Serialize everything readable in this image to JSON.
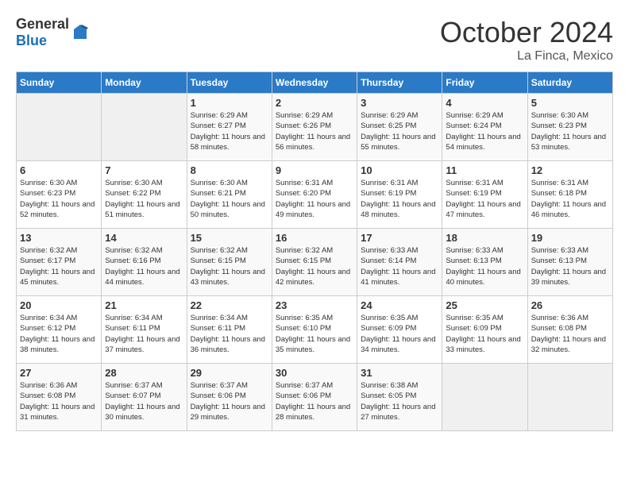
{
  "header": {
    "logo_general": "General",
    "logo_blue": "Blue",
    "month": "October 2024",
    "location": "La Finca, Mexico"
  },
  "weekdays": [
    "Sunday",
    "Monday",
    "Tuesday",
    "Wednesday",
    "Thursday",
    "Friday",
    "Saturday"
  ],
  "weeks": [
    [
      {
        "day": "",
        "sunrise": "",
        "sunset": "",
        "daylight": "",
        "empty": true
      },
      {
        "day": "",
        "sunrise": "",
        "sunset": "",
        "daylight": "",
        "empty": true
      },
      {
        "day": "1",
        "sunrise": "Sunrise: 6:29 AM",
        "sunset": "Sunset: 6:27 PM",
        "daylight": "Daylight: 11 hours and 58 minutes."
      },
      {
        "day": "2",
        "sunrise": "Sunrise: 6:29 AM",
        "sunset": "Sunset: 6:26 PM",
        "daylight": "Daylight: 11 hours and 56 minutes."
      },
      {
        "day": "3",
        "sunrise": "Sunrise: 6:29 AM",
        "sunset": "Sunset: 6:25 PM",
        "daylight": "Daylight: 11 hours and 55 minutes."
      },
      {
        "day": "4",
        "sunrise": "Sunrise: 6:29 AM",
        "sunset": "Sunset: 6:24 PM",
        "daylight": "Daylight: 11 hours and 54 minutes."
      },
      {
        "day": "5",
        "sunrise": "Sunrise: 6:30 AM",
        "sunset": "Sunset: 6:23 PM",
        "daylight": "Daylight: 11 hours and 53 minutes."
      }
    ],
    [
      {
        "day": "6",
        "sunrise": "Sunrise: 6:30 AM",
        "sunset": "Sunset: 6:23 PM",
        "daylight": "Daylight: 11 hours and 52 minutes."
      },
      {
        "day": "7",
        "sunrise": "Sunrise: 6:30 AM",
        "sunset": "Sunset: 6:22 PM",
        "daylight": "Daylight: 11 hours and 51 minutes."
      },
      {
        "day": "8",
        "sunrise": "Sunrise: 6:30 AM",
        "sunset": "Sunset: 6:21 PM",
        "daylight": "Daylight: 11 hours and 50 minutes."
      },
      {
        "day": "9",
        "sunrise": "Sunrise: 6:31 AM",
        "sunset": "Sunset: 6:20 PM",
        "daylight": "Daylight: 11 hours and 49 minutes."
      },
      {
        "day": "10",
        "sunrise": "Sunrise: 6:31 AM",
        "sunset": "Sunset: 6:19 PM",
        "daylight": "Daylight: 11 hours and 48 minutes."
      },
      {
        "day": "11",
        "sunrise": "Sunrise: 6:31 AM",
        "sunset": "Sunset: 6:19 PM",
        "daylight": "Daylight: 11 hours and 47 minutes."
      },
      {
        "day": "12",
        "sunrise": "Sunrise: 6:31 AM",
        "sunset": "Sunset: 6:18 PM",
        "daylight": "Daylight: 11 hours and 46 minutes."
      }
    ],
    [
      {
        "day": "13",
        "sunrise": "Sunrise: 6:32 AM",
        "sunset": "Sunset: 6:17 PM",
        "daylight": "Daylight: 11 hours and 45 minutes."
      },
      {
        "day": "14",
        "sunrise": "Sunrise: 6:32 AM",
        "sunset": "Sunset: 6:16 PM",
        "daylight": "Daylight: 11 hours and 44 minutes."
      },
      {
        "day": "15",
        "sunrise": "Sunrise: 6:32 AM",
        "sunset": "Sunset: 6:15 PM",
        "daylight": "Daylight: 11 hours and 43 minutes."
      },
      {
        "day": "16",
        "sunrise": "Sunrise: 6:32 AM",
        "sunset": "Sunset: 6:15 PM",
        "daylight": "Daylight: 11 hours and 42 minutes."
      },
      {
        "day": "17",
        "sunrise": "Sunrise: 6:33 AM",
        "sunset": "Sunset: 6:14 PM",
        "daylight": "Daylight: 11 hours and 41 minutes."
      },
      {
        "day": "18",
        "sunrise": "Sunrise: 6:33 AM",
        "sunset": "Sunset: 6:13 PM",
        "daylight": "Daylight: 11 hours and 40 minutes."
      },
      {
        "day": "19",
        "sunrise": "Sunrise: 6:33 AM",
        "sunset": "Sunset: 6:13 PM",
        "daylight": "Daylight: 11 hours and 39 minutes."
      }
    ],
    [
      {
        "day": "20",
        "sunrise": "Sunrise: 6:34 AM",
        "sunset": "Sunset: 6:12 PM",
        "daylight": "Daylight: 11 hours and 38 minutes."
      },
      {
        "day": "21",
        "sunrise": "Sunrise: 6:34 AM",
        "sunset": "Sunset: 6:11 PM",
        "daylight": "Daylight: 11 hours and 37 minutes."
      },
      {
        "day": "22",
        "sunrise": "Sunrise: 6:34 AM",
        "sunset": "Sunset: 6:11 PM",
        "daylight": "Daylight: 11 hours and 36 minutes."
      },
      {
        "day": "23",
        "sunrise": "Sunrise: 6:35 AM",
        "sunset": "Sunset: 6:10 PM",
        "daylight": "Daylight: 11 hours and 35 minutes."
      },
      {
        "day": "24",
        "sunrise": "Sunrise: 6:35 AM",
        "sunset": "Sunset: 6:09 PM",
        "daylight": "Daylight: 11 hours and 34 minutes."
      },
      {
        "day": "25",
        "sunrise": "Sunrise: 6:35 AM",
        "sunset": "Sunset: 6:09 PM",
        "daylight": "Daylight: 11 hours and 33 minutes."
      },
      {
        "day": "26",
        "sunrise": "Sunrise: 6:36 AM",
        "sunset": "Sunset: 6:08 PM",
        "daylight": "Daylight: 11 hours and 32 minutes."
      }
    ],
    [
      {
        "day": "27",
        "sunrise": "Sunrise: 6:36 AM",
        "sunset": "Sunset: 6:08 PM",
        "daylight": "Daylight: 11 hours and 31 minutes."
      },
      {
        "day": "28",
        "sunrise": "Sunrise: 6:37 AM",
        "sunset": "Sunset: 6:07 PM",
        "daylight": "Daylight: 11 hours and 30 minutes."
      },
      {
        "day": "29",
        "sunrise": "Sunrise: 6:37 AM",
        "sunset": "Sunset: 6:06 PM",
        "daylight": "Daylight: 11 hours and 29 minutes."
      },
      {
        "day": "30",
        "sunrise": "Sunrise: 6:37 AM",
        "sunset": "Sunset: 6:06 PM",
        "daylight": "Daylight: 11 hours and 28 minutes."
      },
      {
        "day": "31",
        "sunrise": "Sunrise: 6:38 AM",
        "sunset": "Sunset: 6:05 PM",
        "daylight": "Daylight: 11 hours and 27 minutes."
      },
      {
        "day": "",
        "sunrise": "",
        "sunset": "",
        "daylight": "",
        "empty": true
      },
      {
        "day": "",
        "sunrise": "",
        "sunset": "",
        "daylight": "",
        "empty": true
      }
    ]
  ]
}
